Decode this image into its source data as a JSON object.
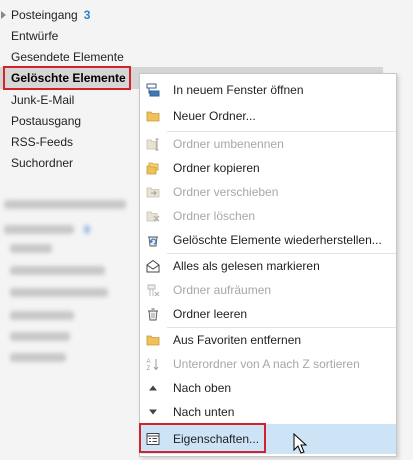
{
  "folders": [
    {
      "label": "Posteingang",
      "count": "3"
    },
    {
      "label": "Entwürfe"
    },
    {
      "label": "Gesendete Elemente"
    },
    {
      "label": "Gelöschte Elemente"
    },
    {
      "label": "Junk-E-Mail"
    },
    {
      "label": "Postausgang"
    },
    {
      "label": "RSS-Feeds"
    },
    {
      "label": "Suchordner"
    }
  ],
  "context_menu": {
    "items": [
      {
        "label": "In neuem Fenster öffnen",
        "enabled": true,
        "icon": "open-window-icon"
      },
      {
        "label": "Neuer Ordner...",
        "enabled": true,
        "icon": "new-folder-icon"
      },
      {
        "label": "Ordner umbenennen",
        "enabled": false,
        "icon": "rename-folder-icon"
      },
      {
        "label": "Ordner kopieren",
        "enabled": true,
        "icon": "copy-folder-icon"
      },
      {
        "label": "Ordner verschieben",
        "enabled": false,
        "icon": "move-folder-icon"
      },
      {
        "label": "Ordner löschen",
        "enabled": false,
        "icon": "delete-folder-icon"
      },
      {
        "label": "Gelöschte Elemente wiederherstellen...",
        "enabled": true,
        "icon": "restore-icon"
      },
      {
        "label": "Alles als gelesen markieren",
        "enabled": true,
        "icon": "mark-read-icon"
      },
      {
        "label": "Ordner aufräumen",
        "enabled": false,
        "icon": "cleanup-icon"
      },
      {
        "label": "Ordner leeren",
        "enabled": true,
        "icon": "empty-folder-icon"
      },
      {
        "label": "Aus Favoriten entfernen",
        "enabled": true,
        "icon": "remove-favorite-icon"
      },
      {
        "label": "Unterordner von A nach Z sortieren",
        "enabled": false,
        "icon": "sort-az-icon"
      },
      {
        "label": "Nach oben",
        "enabled": true,
        "icon": "arrow-up-icon"
      },
      {
        "label": "Nach unten",
        "enabled": true,
        "icon": "arrow-down-icon"
      },
      {
        "label": "Eigenschaften...",
        "enabled": true,
        "icon": "properties-icon"
      }
    ]
  },
  "colors": {
    "accent": "#2e7fd2",
    "highlight": "#cde4f7",
    "annotation_red": "#d2232a",
    "disabled_text": "#a7a7a7"
  }
}
